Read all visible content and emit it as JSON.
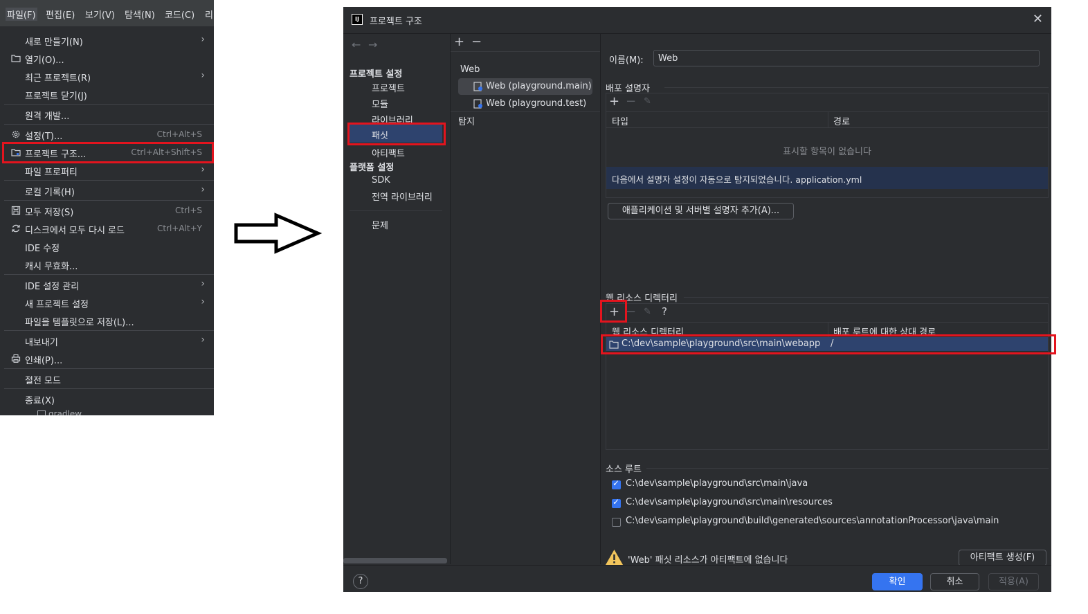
{
  "menubar": {
    "items": [
      "파일(F)",
      "편집(E)",
      "보기(V)",
      "탐색(N)",
      "코드(C)",
      "리"
    ]
  },
  "file_menu": {
    "new": "새로 만들기(N)",
    "open": "열기(O)...",
    "recent": "최근 프로젝트(R)",
    "close": "프로젝트 닫기(J)",
    "remote": "원격 개발...",
    "settings": "설정(T)...",
    "settings_sc": "Ctrl+Alt+S",
    "structure": "프로젝트 구조...",
    "structure_sc": "Ctrl+Alt+Shift+S",
    "file_props": "파일 프로퍼티",
    "local_history": "로컬 기록(H)",
    "save_all": "모두 저장(S)",
    "save_all_sc": "Ctrl+S",
    "reload": "디스크에서 모두 다시 로드",
    "reload_sc": "Ctrl+Alt+Y",
    "ide_fix": "IDE 수정",
    "invalidate": "캐시 무효화...",
    "ide_settings": "IDE 설정 관리",
    "new_project_settings": "새 프로젝트 설정",
    "save_template": "파일을 템플릿으로 저장(L)...",
    "export": "내보내기",
    "print": "인쇄(P)...",
    "power_save": "절전 모드",
    "exit": "종료(X)",
    "behind": "gradlew"
  },
  "dialog": {
    "title": "프로젝트 구조",
    "sidebar": {
      "project_settings": "프로젝트 설정",
      "project": "프로젝트",
      "modules": "모듈",
      "libraries": "라이브러리",
      "facets": "패싯",
      "artifacts": "아티팩트",
      "platform_settings": "플랫폼 설정",
      "sdk": "SDK",
      "global_libraries": "전역 라이브러리",
      "problems": "문제"
    },
    "middle": {
      "group": "Web",
      "items": [
        "Web (playground.main)",
        "Web (playground.test)"
      ],
      "detect": "탐지"
    },
    "right": {
      "name_label": "이름(M):",
      "name_value": "Web",
      "deploy_header": "배포 설명자",
      "col_type": "타입",
      "col_path": "경로",
      "empty_text": "표시할 항목이 없습니다",
      "detected_text": "다음에서 설명자 설정이 자동으로 탐지되었습니다. application.yml",
      "add_descriptor_btn": "애플리케이션 및 서버별 설명자 추가(A)...",
      "web_res_header": "웹 리소스 디렉터리",
      "col_web_dir": "웹 리소스 디렉터리",
      "col_rel_path": "배포 루트에 대한 상대 경로",
      "web_dir_path": "C:\\dev\\sample\\playground\\src\\main\\webapp",
      "web_dir_rel": "/",
      "source_roots_header": "소스 루트",
      "source_roots": [
        {
          "path": "C:\\dev\\sample\\playground\\src\\main\\java",
          "checked": true
        },
        {
          "path": "C:\\dev\\sample\\playground\\src\\main\\resources",
          "checked": true
        },
        {
          "path": "C:\\dev\\sample\\playground\\build\\generated\\sources\\annotationProcessor\\java\\main",
          "checked": false
        }
      ],
      "warning": "'Web' 패싯 리소스가 아티팩트에 없습니다",
      "create_artifact_btn": "아티팩트 생성(F)"
    },
    "footer": {
      "help": "?",
      "ok": "확인",
      "cancel": "취소",
      "apply": "적용(A)"
    }
  },
  "colors": {
    "highlight": "#e3141e",
    "accent": "#3574f0",
    "bg": "#2b2d30"
  }
}
